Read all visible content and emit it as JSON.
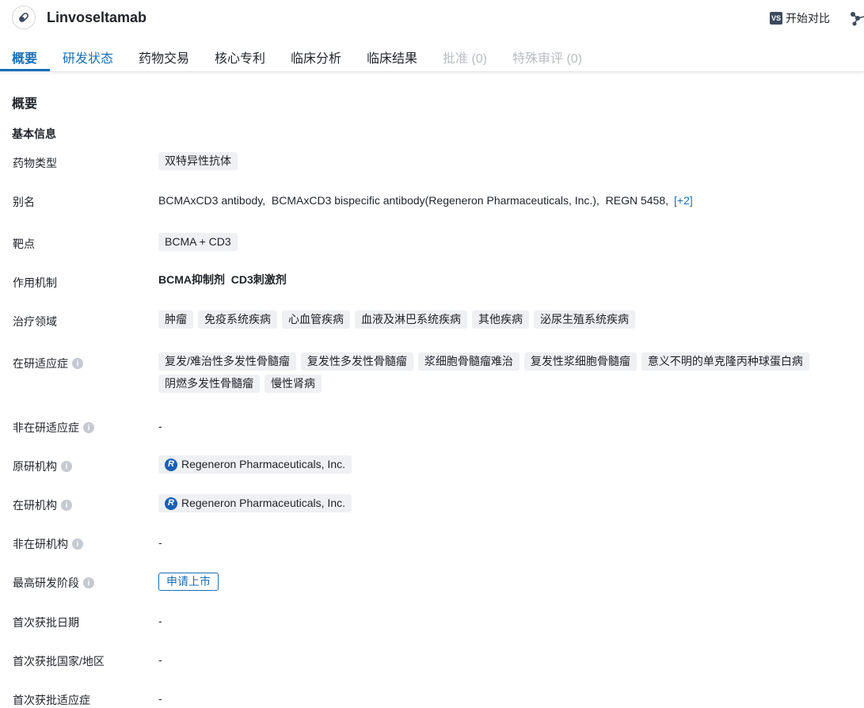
{
  "header": {
    "title": "Linvoseltamab",
    "compare_label": "开始对比",
    "vs_badge": "VS"
  },
  "tabs": [
    {
      "label": "概要"
    },
    {
      "label": "研发状态"
    },
    {
      "label": "药物交易"
    },
    {
      "label": "核心专利"
    },
    {
      "label": "临床分析"
    },
    {
      "label": "临床结果"
    },
    {
      "label": "批准 (0)"
    },
    {
      "label": "特殊审评 (0)"
    }
  ],
  "section": {
    "title": "概要",
    "subtitle": "基本信息"
  },
  "info": {
    "drug_type": {
      "label": "药物类型",
      "chips": [
        "双特异性抗体"
      ]
    },
    "alias": {
      "label": "别名",
      "text": "BCMAxCD3 antibody,  BCMAxCD3 bispecific antibody(Regeneron Pharmaceuticals, Inc.),  REGN 5458,",
      "more": "[+2]"
    },
    "target": {
      "label": "靶点",
      "chips": [
        "BCMA + CD3"
      ]
    },
    "mechanism": {
      "label": "作用机制",
      "text": "BCMA抑制剂  CD3刺激剂"
    },
    "therapeutic_area": {
      "label": "治疗领域",
      "chips": [
        "肿瘤",
        "免疫系统疾病",
        "心血管疾病",
        "血液及淋巴系统疾病",
        "其他疾病",
        "泌尿生殖系统疾病"
      ]
    },
    "active_indication": {
      "label": "在研适应症",
      "chips": [
        "复发/难治性多发性骨髓瘤",
        "复发性多发性骨髓瘤",
        "浆细胞骨髓瘤难治",
        "复发性浆细胞骨髓瘤",
        "意义不明的单克隆丙种球蛋白病",
        "阴燃多发性骨髓瘤",
        "慢性肾病"
      ]
    },
    "inactive_indication": {
      "label": "非在研适应症",
      "text": "-"
    },
    "originator": {
      "label": "原研机构",
      "org": "Regeneron Pharmaceuticals, Inc.",
      "logo_letter": "R"
    },
    "active_org": {
      "label": "在研机构",
      "org": "Regeneron Pharmaceuticals, Inc.",
      "logo_letter": "R"
    },
    "inactive_org": {
      "label": "非在研机构",
      "text": "-"
    },
    "highest_phase": {
      "label": "最高研发阶段",
      "stage": "申请上市"
    },
    "first_approval_date": {
      "label": "首次获批日期",
      "text": "-"
    },
    "first_approval_region": {
      "label": "首次获批国家/地区",
      "text": "-"
    },
    "first_approval_indication": {
      "label": "首次获批适应症",
      "text": "-"
    }
  },
  "icons": {
    "drug": "pill-icon",
    "info": "info-icon",
    "graph": "network-graph-icon"
  },
  "colors": {
    "accent": "#1a6fb5",
    "chip_bg": "#eef0f3",
    "disabled": "#b8bcc4"
  }
}
